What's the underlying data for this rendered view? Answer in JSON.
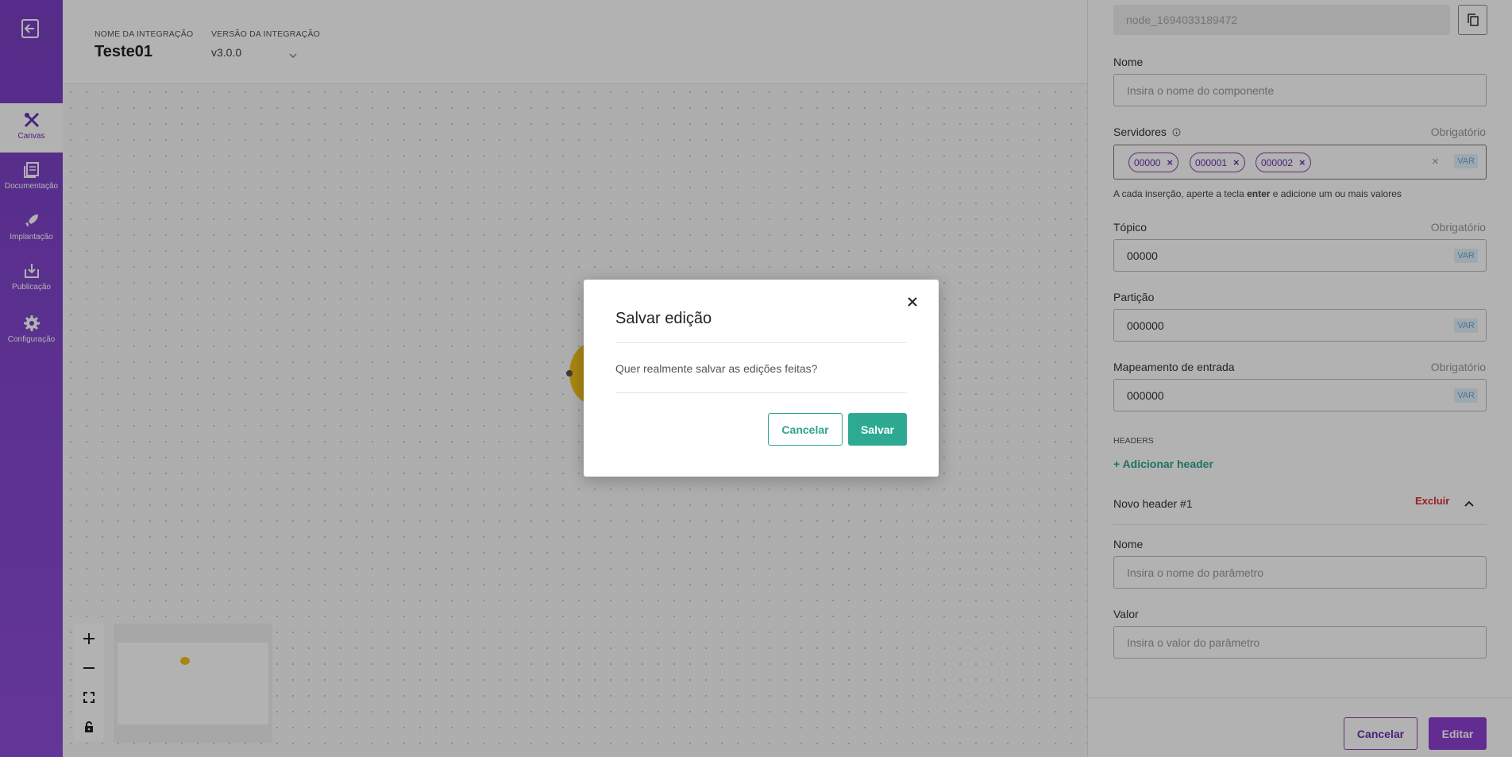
{
  "sidebar": {
    "items": [
      {
        "label": "Canvas",
        "icon": "canvas-icon",
        "active": true
      },
      {
        "label": "Documentação",
        "icon": "document-icon",
        "active": false
      },
      {
        "label": "Implantação",
        "icon": "rocket-icon",
        "active": false
      },
      {
        "label": "Publicação",
        "icon": "publish-icon",
        "active": false
      },
      {
        "label": "Configuração",
        "icon": "gear-icon",
        "active": false
      }
    ]
  },
  "header": {
    "name_label": "NOME DA INTEGRAÇÃO",
    "name_value": "Teste01",
    "version_label": "VERSÃO DA INTEGRAÇÃO",
    "version_value": "v3.0.0"
  },
  "panel": {
    "node_id": "node_1694033189472",
    "nome_label": "Nome",
    "nome_placeholder": "Insira o nome do componente",
    "servidores_label": "Servidores",
    "required_label": "Obrigatório",
    "servers": [
      "00000",
      "000001",
      "000002"
    ],
    "var_label": "VAR",
    "hint_prefix": "A cada inserção, aperte a tecla ",
    "hint_key": "enter",
    "hint_suffix": " e adicione um ou mais valores",
    "topico_label": "Tópico",
    "topico_value": "00000",
    "particao_label": "Partição",
    "particao_value": "000000",
    "mapeamento_label": "Mapeamento de entrada",
    "mapeamento_value": "000000",
    "headers_title": "HEADERS",
    "add_header_label": "+ Adicionar header",
    "header_item_title": "Novo header #1",
    "excluir_label": "Excluir",
    "header_nome_label": "Nome",
    "header_nome_placeholder": "Insira o nome do parâmetro",
    "header_valor_label": "Valor",
    "header_valor_placeholder": "Insira o valor do parâmetro",
    "cancel_label": "Cancelar",
    "edit_label": "Editar"
  },
  "dialog": {
    "title": "Salvar edição",
    "message": "Quer realmente salvar as edições feitas?",
    "cancel_label": "Cancelar",
    "save_label": "Salvar"
  },
  "colors": {
    "sidebar": "#7a3fc4",
    "accent_green": "#2ea48e",
    "accent_purple": "#8e3fd1",
    "danger": "#d93030",
    "node": "#f3c11b"
  }
}
